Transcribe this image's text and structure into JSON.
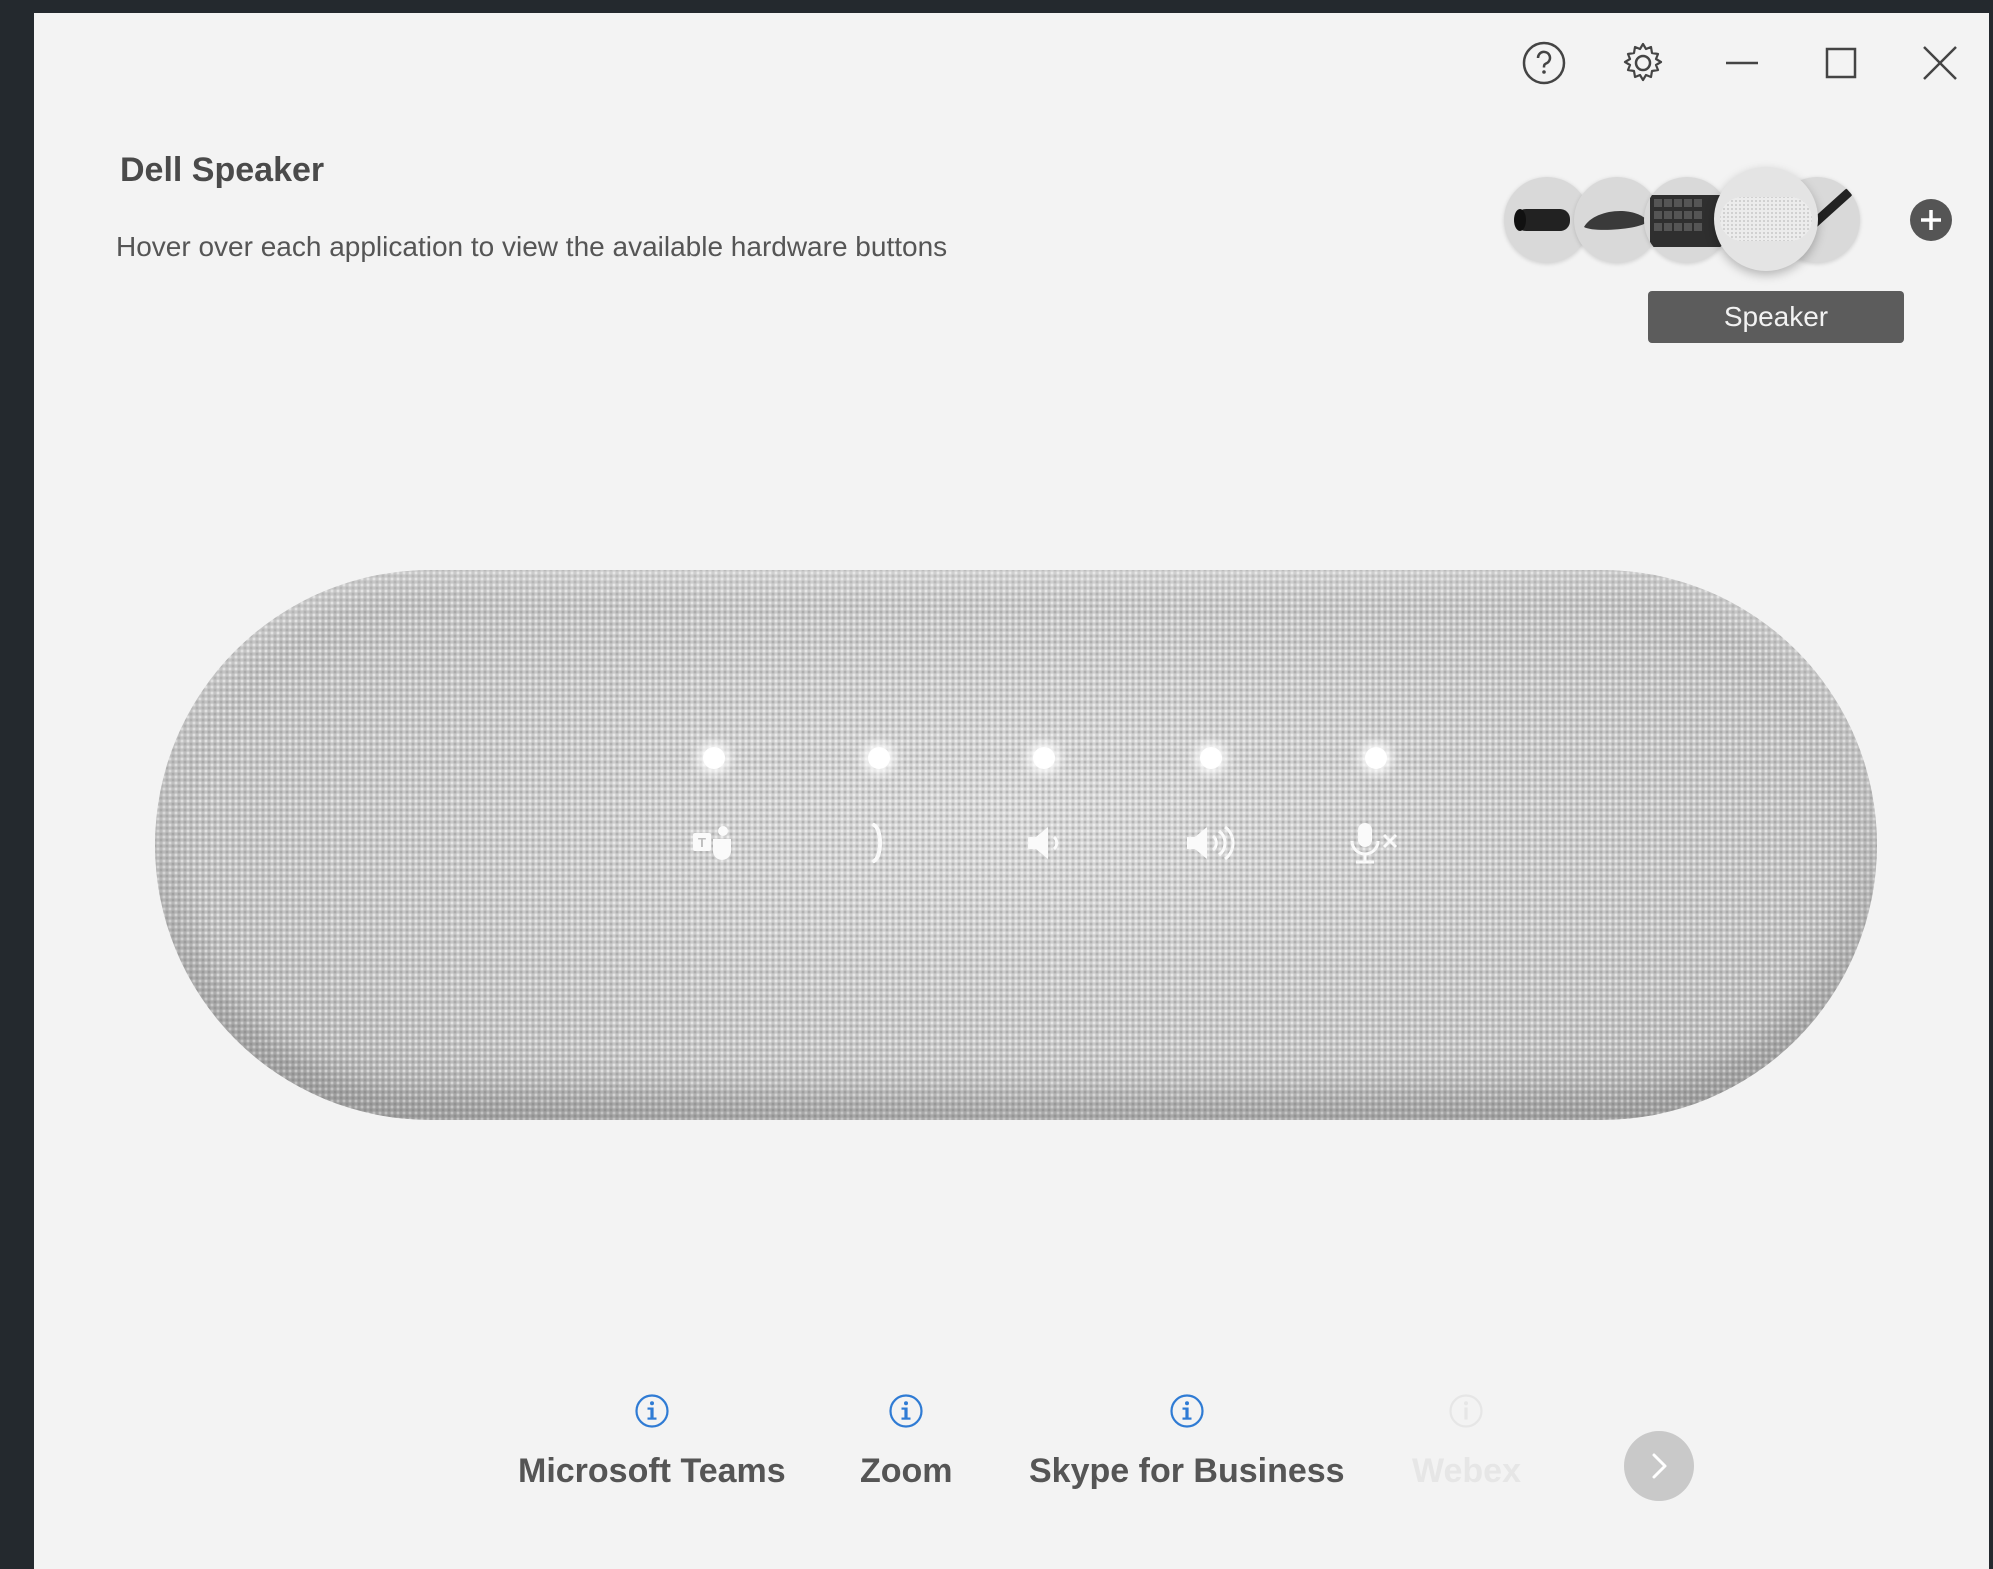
{
  "window": {
    "controls": {
      "help_icon": "help-icon",
      "settings_icon": "gear-icon",
      "minimize_icon": "minimize-icon",
      "maximize_icon": "maximize-icon",
      "close_icon": "close-icon"
    }
  },
  "device": {
    "title": "Dell Speaker",
    "subtitle": "Hover over each application to view the available hardware buttons"
  },
  "device_strip": {
    "items": [
      {
        "name": "Webcam",
        "icon": "webcam-icon"
      },
      {
        "name": "Mouse",
        "icon": "mouse-icon"
      },
      {
        "name": "Keyboard",
        "icon": "keyboard-icon"
      },
      {
        "name": "Speaker",
        "icon": "speaker-icon",
        "selected": true
      },
      {
        "name": "Pen",
        "icon": "pen-icon"
      }
    ],
    "tooltip": "Speaker",
    "add_icon": "plus-icon"
  },
  "speaker_buttons": [
    {
      "name": "teams",
      "icon": "teams-icon"
    },
    {
      "name": "call",
      "icon": "phone-icon"
    },
    {
      "name": "volume-down",
      "icon": "volume-down-icon"
    },
    {
      "name": "volume-up",
      "icon": "volume-up-icon"
    },
    {
      "name": "mute",
      "icon": "mic-mute-icon"
    }
  ],
  "apps": {
    "items": [
      {
        "label": "Microsoft Teams",
        "info_icon": "info-icon"
      },
      {
        "label": "Zoom",
        "info_icon": "info-icon"
      },
      {
        "label": "Skype for Business",
        "info_icon": "info-icon"
      },
      {
        "label": "Webex",
        "info_icon": "info-icon"
      }
    ],
    "next_icon": "chevron-right-icon"
  },
  "colors": {
    "window_bg": "#f3f3f3",
    "frame_bg": "#24292e",
    "accent_blue": "#2f7bd4",
    "tooltip_bg": "#5c5c5c"
  }
}
